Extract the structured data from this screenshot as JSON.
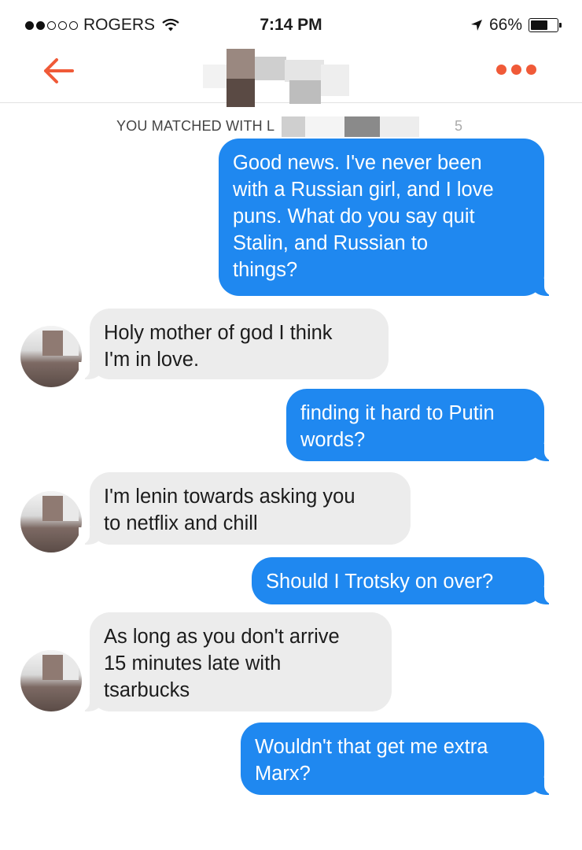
{
  "status_bar": {
    "carrier": "ROGERS",
    "time": "7:14 PM",
    "battery": "66%",
    "battery_level": 0.66
  },
  "nav": {
    "back_icon": "back-arrow-icon",
    "more_icon": "more-dots-icon",
    "accent_color": "#f05a38"
  },
  "match_banner": {
    "text": "YOU MATCHED WITH L",
    "trailing": "5"
  },
  "messages": [
    {
      "from": "me",
      "text": "Good news. I've never been\nwith a Russian girl, and I love\npuns. What do you say quit\nStalin, and Russian to\nthings?"
    },
    {
      "from": "match",
      "text": "Holy mother of god I think\nI'm in love."
    },
    {
      "from": "me",
      "text": "finding it hard to Putin\nwords?"
    },
    {
      "from": "match",
      "text": "I'm lenin towards asking you\nto netflix and chill"
    },
    {
      "from": "me",
      "text": "Should I Trotsky on over?"
    },
    {
      "from": "match",
      "text": "As long as you don't arrive\n15 minutes late with\ntsarbucks"
    },
    {
      "from": "me",
      "text": "Wouldn't that get me extra\nMarx?"
    }
  ],
  "colors": {
    "sent_bubble": "#1f88f0",
    "received_bubble": "#ececec"
  }
}
